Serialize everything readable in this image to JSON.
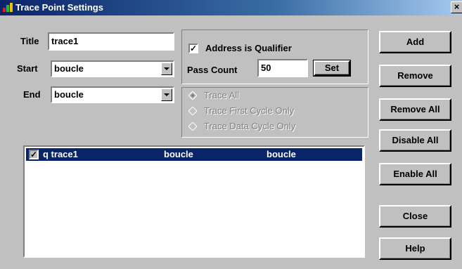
{
  "window": {
    "title": "Trace Point Settings",
    "close_glyph": "×"
  },
  "fields": {
    "title_label": "Title",
    "title_value": "trace1",
    "start_label": "Start",
    "start_value": "boucle",
    "end_label": "End",
    "end_value": "boucle"
  },
  "qualifier": {
    "address_checkbox_mark": "✓",
    "address_label": "Address is Qualifier",
    "pass_count_label": "Pass Count",
    "pass_count_value": "50",
    "set_label": "Set"
  },
  "trace_mode": {
    "options": [
      {
        "label": "Trace All",
        "selected": true
      },
      {
        "label": "Trace First Cycle Only",
        "selected": false
      },
      {
        "label": "Trace Data Cycle Only",
        "selected": false
      }
    ]
  },
  "list": {
    "rows": [
      {
        "checked_mark": "✓",
        "name": "q trace1",
        "start": "boucle",
        "end": "boucle"
      }
    ]
  },
  "buttons": {
    "add": "Add",
    "remove": "Remove",
    "remove_all": "Remove All",
    "disable_all": "Disable All",
    "enable_all": "Enable All",
    "close": "Close",
    "help": "Help"
  },
  "colors": {
    "face": "#c0c0c0",
    "title_gradient_start": "#0a246a",
    "selection": "#0a246a",
    "disabled_text": "#808080"
  }
}
